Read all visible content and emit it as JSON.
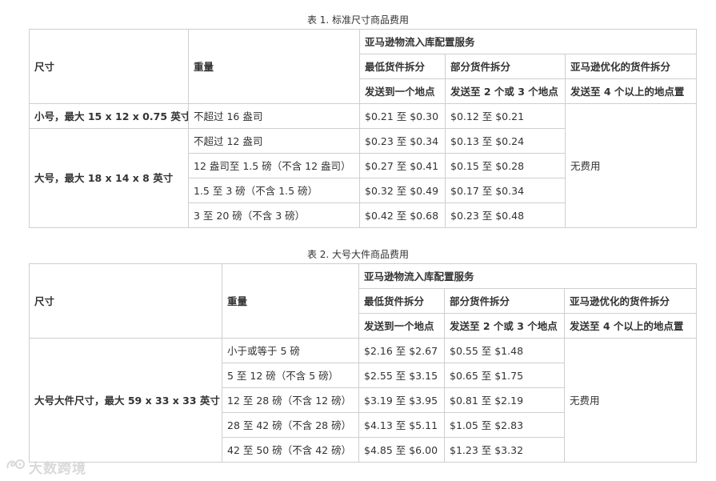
{
  "table1": {
    "caption": "表 1. 标准尺寸商品费用",
    "header": {
      "size": "尺寸",
      "weight": "重量",
      "service": "亚马逊物流入库配置服务",
      "min_split": "最低货件拆分",
      "partial_split": "部分货件拆分",
      "optimized_split": "亚马逊优化的货件拆分",
      "one_location": "发送到一个地点",
      "two_three_locations": "发送至 2 个或 3 个地点",
      "four_plus_locations": "发送至 4 个以上的地点置"
    },
    "groups": [
      {
        "size": "小号，最大 15 x 12 x 0.75 英寸",
        "rows": [
          {
            "weight": "不超过 16 盎司",
            "min": "$0.21 至 $0.30",
            "partial": "$0.12 至 $0.21"
          }
        ]
      },
      {
        "size": "大号，最大 18 x 14 x 8 英寸",
        "rows": [
          {
            "weight": "不超过 12 盎司",
            "min": "$0.23 至 $0.34",
            "partial": "$0.13 至 $0.24"
          },
          {
            "weight": "12 盎司至 1.5 磅（不含 12 盎司）",
            "min": "$0.27 至 $0.41",
            "partial": "$0.15 至 $0.28"
          },
          {
            "weight": "1.5 至 3 磅（不含 1.5 磅）",
            "min": "$0.32 至 $0.49",
            "partial": "$0.17 至 $0.34"
          },
          {
            "weight": "3 至 20 磅（不含 3 磅）",
            "min": "$0.42 至 $0.68",
            "partial": "$0.23 至 $0.48"
          }
        ]
      }
    ],
    "optimized_value": "无费用"
  },
  "table2": {
    "caption": "表 2. 大号大件商品费用",
    "header": {
      "size": "尺寸",
      "weight": "重量",
      "service": "亚马逊物流入库配置服务",
      "min_split": "最低货件拆分",
      "partial_split": "部分货件拆分",
      "optimized_split": "亚马逊优化的货件拆分",
      "one_location": "发送到一个地点",
      "two_three_locations": "发送至 2 个或 3 个地点",
      "four_plus_locations": "发送至 4 个以上的地点置"
    },
    "size": "大号大件尺寸，最大 59 x 33 x 33 英寸",
    "rows": [
      {
        "weight": "小于或等于 5 磅",
        "min": "$2.16 至 $2.67",
        "partial": "$0.55 至 $1.48"
      },
      {
        "weight": "5 至 12 磅（不含 5 磅）",
        "min": "$2.55 至 $3.15",
        "partial": "$0.65 至 $1.75"
      },
      {
        "weight": "12 至 28 磅（不含 12 磅）",
        "min": "$3.19 至 $3.95",
        "partial": "$0.81 至 $2.19"
      },
      {
        "weight": "28 至 42 磅（不含 28 磅）",
        "min": "$4.13 至 $5.11",
        "partial": "$1.05 至 $2.83"
      },
      {
        "weight": "42 至 50 磅（不含 42 磅）",
        "min": "$4.85 至 $6.00",
        "partial": "$1.23 至 $3.32"
      }
    ],
    "optimized_value": "无费用"
  },
  "watermark": {
    "text": "大数跨境",
    "icon": "logo-icon"
  }
}
